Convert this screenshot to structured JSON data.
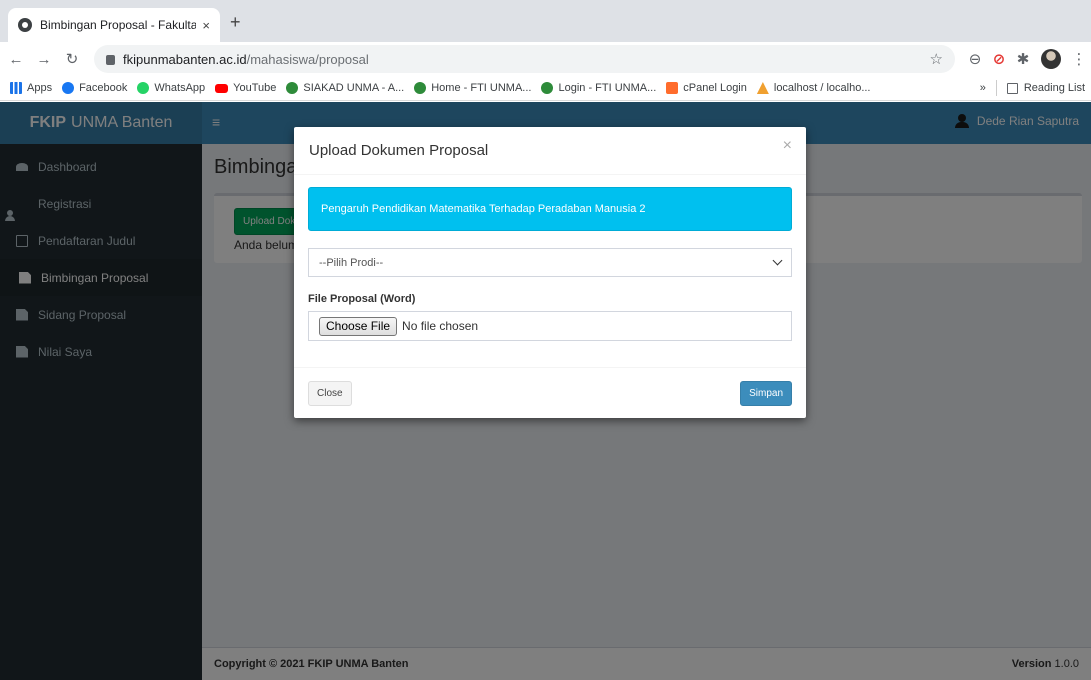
{
  "browser": {
    "tab_title": "Bimbingan Proposal - Fakultas",
    "tab_close": "×",
    "new_tab": "+",
    "url_host": "fkipunmabanten.ac.id",
    "url_path": "/mahasiswa/proposal",
    "bookmarks": [
      "Apps",
      "Facebook",
      "WhatsApp",
      "YouTube",
      "SIAKAD UNMA - A...",
      "Home - FTI UNMA...",
      "Login - FTI UNMA...",
      "cPanel Login",
      "localhost / localho..."
    ],
    "more": "»",
    "reading_list": "Reading List"
  },
  "app": {
    "logo_bold": "FKIP",
    "logo_rest": "UNMA Banten",
    "hamburger": "≡",
    "user_name": "Dede Rian Saputra",
    "sidebar": [
      "Dashboard",
      "Registrasi",
      "Pendaftaran Judul",
      "Bimbingan Proposal",
      "Sidang Proposal",
      "Nilai Saya"
    ],
    "active_item": "Bimbingan Proposal",
    "page_title": "Bimbinga",
    "upload_button": "Upload Dok",
    "info_text": "Anda belum",
    "footer_copyright": "Copyright © 2021 FKIP UNMA Banten",
    "footer_version_label": "Version",
    "footer_version": "1.0.0"
  },
  "modal": {
    "title": "Upload Dokumen Proposal",
    "close_symbol": "×",
    "alert_text": "Pengaruh Pendidikan Matematika Terhadap Peradaban Manusia 2",
    "select_value": "--Pilih Prodi--",
    "file_label": "File Proposal (Word)",
    "choose_file": "Choose File",
    "no_file": "No file chosen",
    "close_button": "Close",
    "save_button": "Simpan"
  },
  "colors": {
    "header_blue": "#3c8dbc",
    "sidebar_dark": "#222d32",
    "alert_cyan": "#00c0ef",
    "success_green": "#00a65a"
  }
}
